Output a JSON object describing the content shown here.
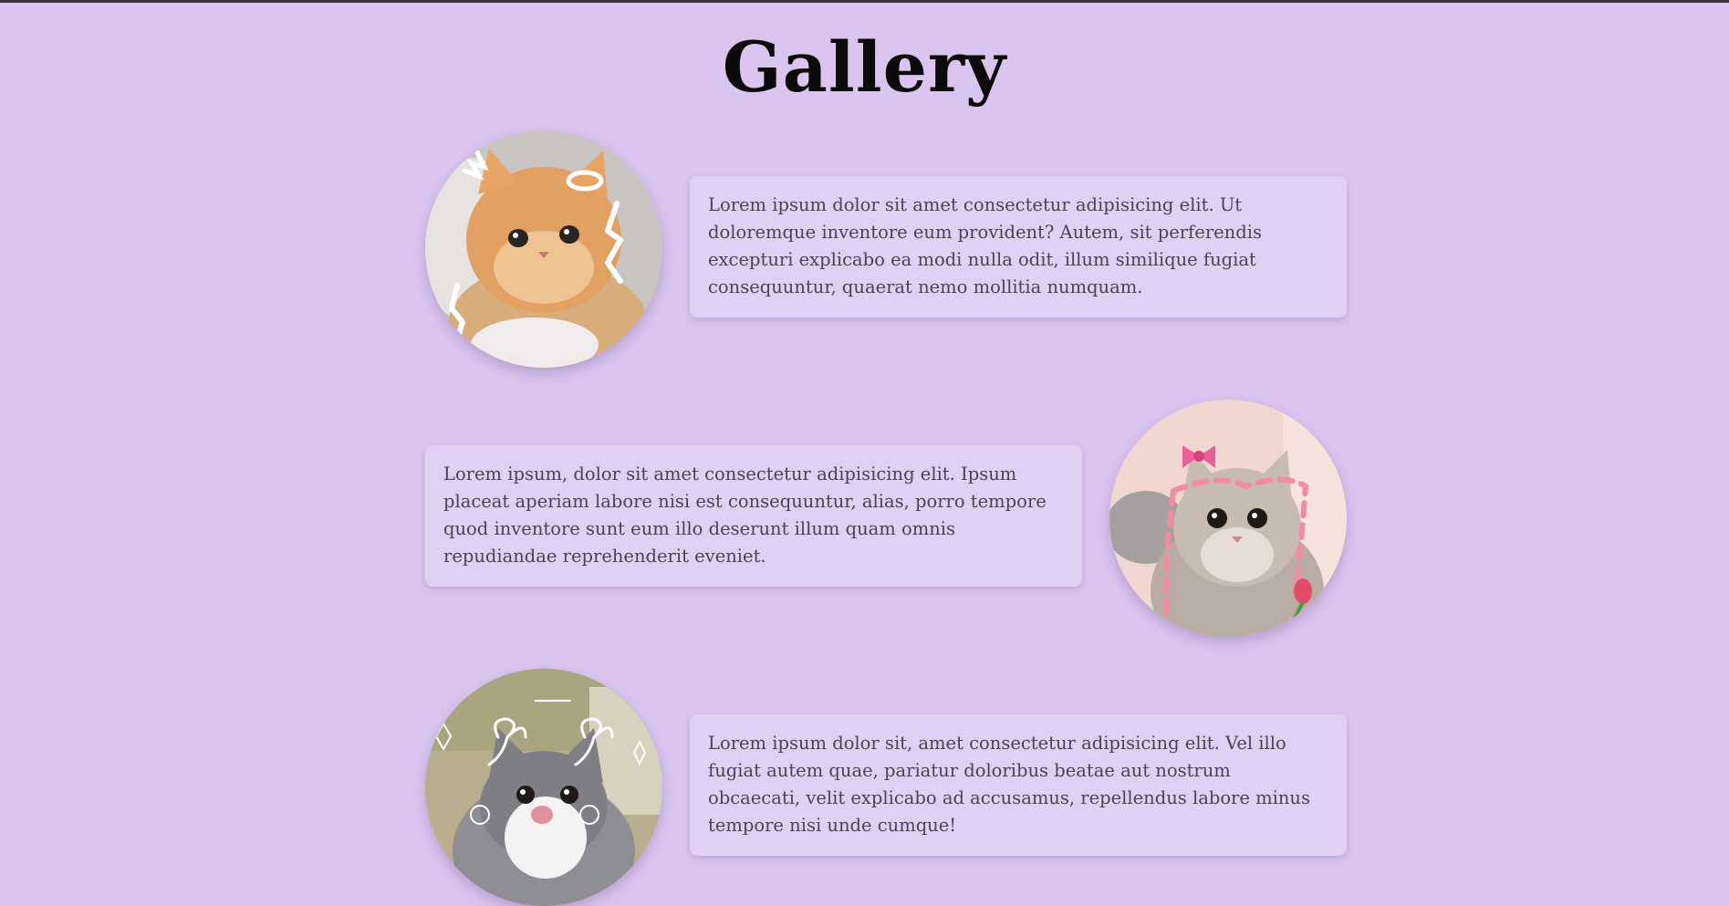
{
  "page": {
    "title": "Gallery"
  },
  "gallery": {
    "items": [
      {
        "photo_icon": "orange-kitten-photo",
        "text": "Lorem ipsum dolor sit amet consectetur adipisicing elit. Ut doloremque inventore eum provident? Autem, sit perferendis excepturi explicabo ea modi nulla odit, illum similique fugiat consequuntur, quaerat nemo mollitia numquam."
      },
      {
        "photo_icon": "grey-cat-with-bow-photo",
        "text": "Lorem ipsum, dolor sit amet consectetur adipisicing elit. Ipsum placeat aperiam labore nisi est consequuntur, alias, porro tempore quod inventore sunt eum illo deserunt illum quam omnis repudiandae reprehenderit eveniet."
      },
      {
        "photo_icon": "tabby-cat-tongue-photo",
        "text": "Lorem ipsum dolor sit, amet consectetur adipisicing elit. Vel illo fugiat autem quae, pariatur doloribus beatae aut nostrum obcaecati, velit explicabo ad accusamus, repellendus labore minus tempore nisi unde cumque!"
      }
    ]
  },
  "colors": {
    "background": "#dbc5f0",
    "card": "#e3cff3",
    "title": "#0b0b0b",
    "text": "#4a4350"
  }
}
